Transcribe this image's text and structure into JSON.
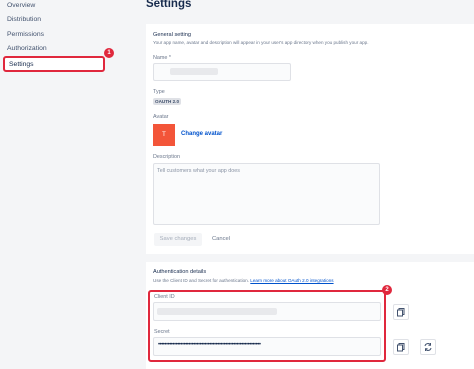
{
  "sidebar": {
    "items": [
      {
        "label": "Overview"
      },
      {
        "label": "Distribution"
      },
      {
        "label": "Permissions"
      },
      {
        "label": "Authorization"
      },
      {
        "label": "Settings"
      }
    ],
    "active_marker": "1"
  },
  "page": {
    "title": "Settings"
  },
  "general": {
    "title": "General setting",
    "description": "Your app name, avatar and description will appear in your user's app directory when you publish your app.",
    "name_label": "Name *",
    "type_label": "Type",
    "type_value": "OAUTH 2.0",
    "avatar_label": "Avatar",
    "avatar_letter": "T",
    "change_avatar": "Change avatar",
    "description_label": "Description",
    "description_placeholder": "Tell customers what your app does",
    "save_label": "Save changes",
    "cancel_label": "Cancel"
  },
  "auth": {
    "title": "Authentication details",
    "description_prefix": "Use the Client ID and Secret for authentication.",
    "learn_more": "Learn more about OAuth 2.0 integrations",
    "client_id_label": "Client ID",
    "secret_label": "Secret",
    "secret_value": "••••••••••••••••••••••••••••••••••••••••••••••••••••••••••••••••",
    "marker": "2"
  },
  "icons": {
    "copy_client_id": "copy-icon",
    "copy_secret": "copy-icon",
    "regenerate": "refresh-icon"
  }
}
